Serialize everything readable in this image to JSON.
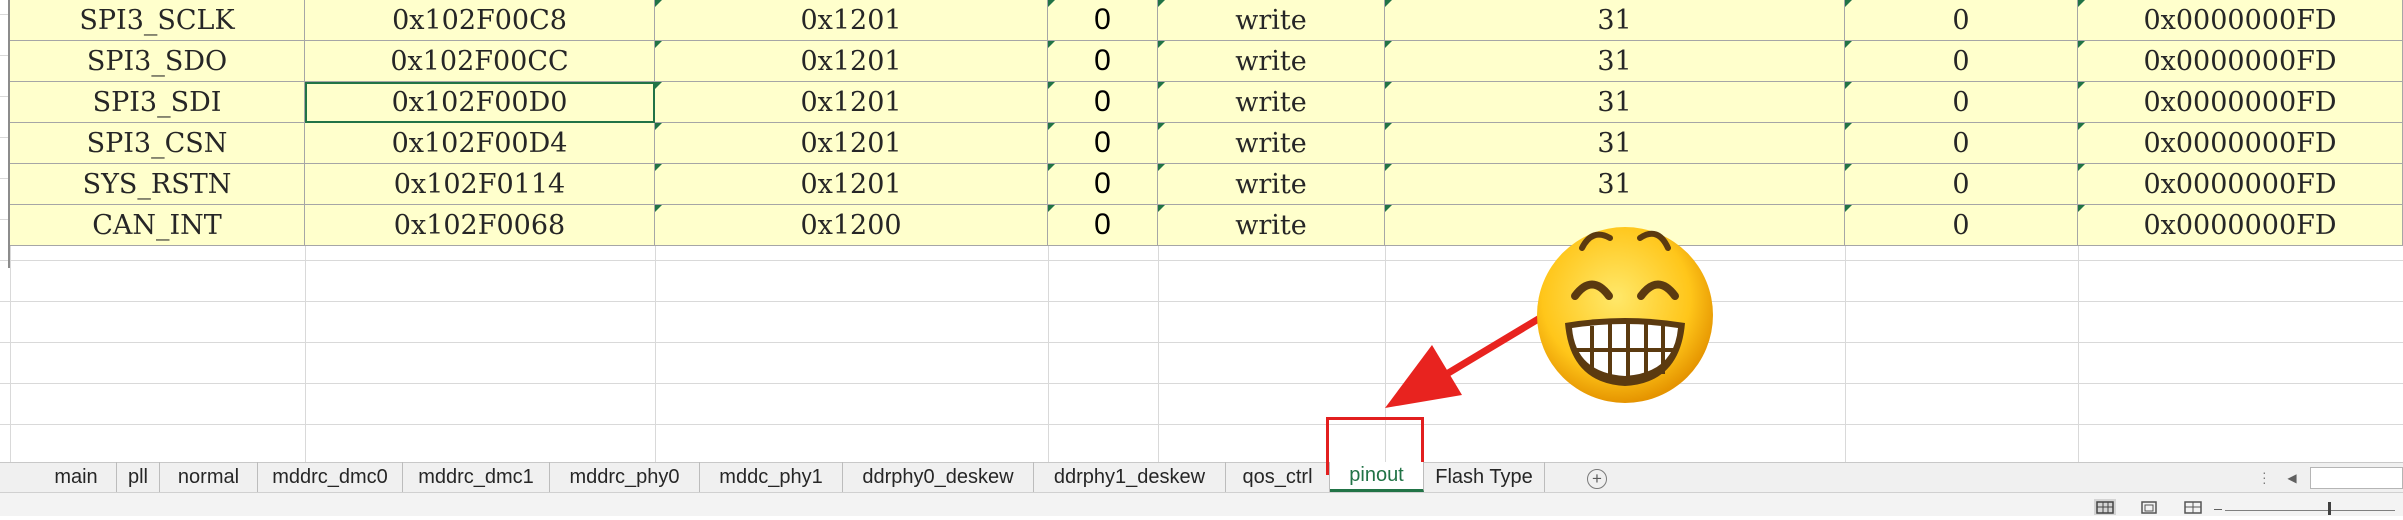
{
  "table": {
    "rows": [
      [
        "SPI3_SCLK",
        "0x102F00C8",
        "0x1201",
        "0",
        "write",
        "31",
        "0",
        "0x0000000FD"
      ],
      [
        "SPI3_SDO",
        "0x102F00CC",
        "0x1201",
        "0",
        "write",
        "31",
        "0",
        "0x0000000FD"
      ],
      [
        "SPI3_SDI",
        "0x102F00D0",
        "0x1201",
        "0",
        "write",
        "31",
        "0",
        "0x0000000FD"
      ],
      [
        "SPI3_CSN",
        "0x102F00D4",
        "0x1201",
        "0",
        "write",
        "31",
        "0",
        "0x0000000FD"
      ],
      [
        "SYS_RSTN",
        "0x102F0114",
        "0x1201",
        "0",
        "write",
        "31",
        "0",
        "0x0000000FD"
      ],
      [
        "CAN_INT",
        "0x102F0068",
        "0x1200",
        "0",
        "write",
        "",
        "0",
        "0x0000000FD"
      ]
    ]
  },
  "sheet_tabs": [
    {
      "label": "main"
    },
    {
      "label": "pll"
    },
    {
      "label": "normal"
    },
    {
      "label": "mddrc_dmc0"
    },
    {
      "label": "mddrc_dmc1"
    },
    {
      "label": "mddrc_phy0"
    },
    {
      "label": "mddc_phy1"
    },
    {
      "label": "ddrphy0_deskew"
    },
    {
      "label": "ddrphy1_deskew"
    },
    {
      "label": "qos_ctrl"
    },
    {
      "label": "pinout",
      "active": true
    },
    {
      "label": "Flash Type"
    }
  ],
  "icons": {
    "add_sheet": "plus-circle-icon",
    "scroll_left": "caret-left-icon",
    "annotation": "grinning-face-emoji",
    "pointer": "red-arrow"
  },
  "colors": {
    "cell_fill": "#ffffcc",
    "active_tab": "#217346",
    "annotation_red": "#e21f1f"
  }
}
